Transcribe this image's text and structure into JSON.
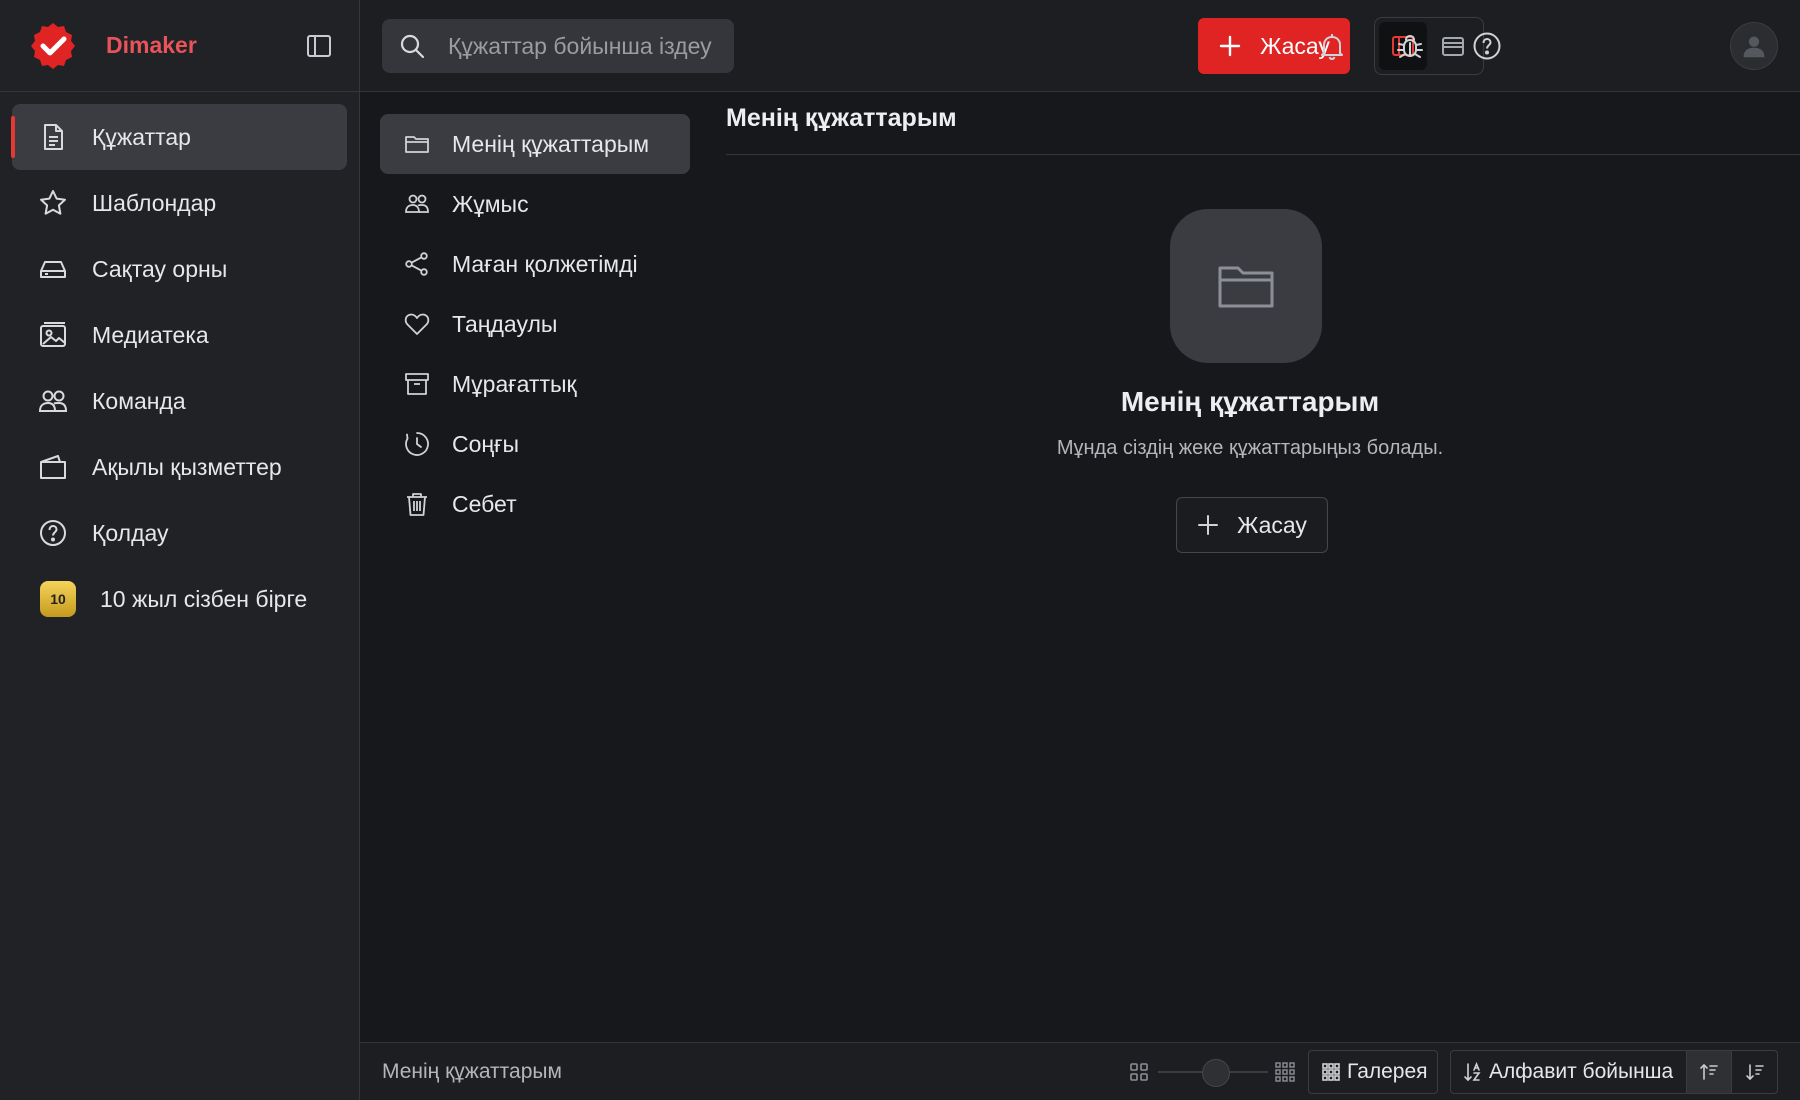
{
  "brand": {
    "name": "Dimaker",
    "accent_color": "#e8545a",
    "logo_color": "#e02424"
  },
  "search": {
    "placeholder": "Құжаттар бойынша іздеу",
    "value": ""
  },
  "header": {
    "create_label": "Жасау"
  },
  "sidebar": {
    "items": [
      {
        "label": "Құжаттар",
        "icon": "document-icon",
        "active": true
      },
      {
        "label": "Шаблондар",
        "icon": "star-icon"
      },
      {
        "label": "Сақтау орны",
        "icon": "storage-icon"
      },
      {
        "label": "Медиатека",
        "icon": "image-icon"
      },
      {
        "label": "Команда",
        "icon": "team-icon"
      },
      {
        "label": "Ақылы қызметтер",
        "icon": "wallet-icon"
      },
      {
        "label": "Қолдау",
        "icon": "help-circle-icon"
      },
      {
        "label": "10 жыл сізбен бірге",
        "icon": "anniversary-badge",
        "badge": "10"
      }
    ]
  },
  "subnav": {
    "items": [
      {
        "label": "Менің құжаттарым",
        "icon": "folder-icon",
        "active": true
      },
      {
        "label": "Жұмыс",
        "icon": "users-icon"
      },
      {
        "label": "Маған қолжетімді",
        "icon": "share-icon"
      },
      {
        "label": "Таңдаулы",
        "icon": "heart-icon"
      },
      {
        "label": "Мұрағаттық",
        "icon": "archive-icon"
      },
      {
        "label": "Соңғы",
        "icon": "clock-icon"
      },
      {
        "label": "Себет",
        "icon": "trash-icon"
      }
    ]
  },
  "main": {
    "title": "Менің құжаттарым",
    "empty": {
      "title": "Менің құжаттарым",
      "description": "Мұнда сіздің жеке құжаттарыңыз болады.",
      "create_label": "Жасау"
    }
  },
  "footer": {
    "label": "Менің құжаттарым",
    "view_label": "Галерея",
    "sort_label": "Алфавит бойынша"
  }
}
